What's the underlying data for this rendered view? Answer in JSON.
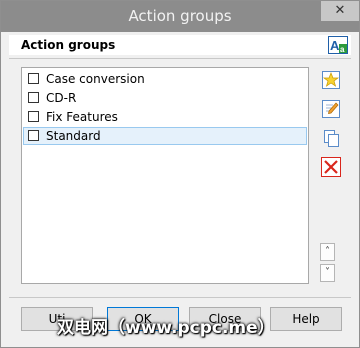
{
  "window": {
    "title": "Action groups",
    "close_glyph": "✕"
  },
  "header": {
    "title": "Action groups",
    "icon": "text-format-icon"
  },
  "list": {
    "items": [
      {
        "label": "Case conversion",
        "checked": false,
        "selected": false
      },
      {
        "label": "CD-R",
        "checked": false,
        "selected": false
      },
      {
        "label": "Fix Features",
        "checked": false,
        "selected": false
      },
      {
        "label": "Standard",
        "checked": false,
        "selected": true
      }
    ]
  },
  "side_buttons": {
    "new_icon": "new-star-icon",
    "edit_icon": "edit-pencil-icon",
    "copy_icon": "copy-icon",
    "delete_icon": "delete-x-icon",
    "up_glyph": "˄",
    "down_glyph": "˅"
  },
  "buttons": {
    "utilities": "Uti",
    "ok": "OK",
    "close": "Close",
    "help": "Help"
  },
  "watermark": "双电网（www.pcpc.me）",
  "colors": {
    "titlebar": "#8c8c8c",
    "selection": "#e5f1fb",
    "delete_red": "#d9261c",
    "default_button_border": "#0078d7"
  }
}
